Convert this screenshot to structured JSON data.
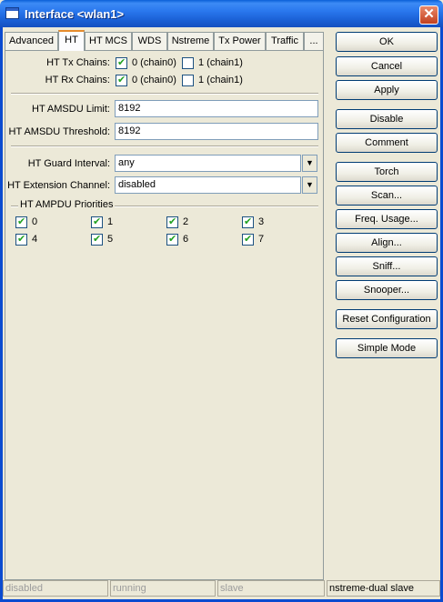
{
  "window": {
    "title": "Interface <wlan1>",
    "icon": "window-icon"
  },
  "tabs": [
    {
      "label": "Advanced",
      "active": false
    },
    {
      "label": "HT",
      "active": true
    },
    {
      "label": "HT MCS",
      "active": false
    },
    {
      "label": "WDS",
      "active": false
    },
    {
      "label": "Nstreme",
      "active": false
    },
    {
      "label": "Tx Power",
      "active": false
    },
    {
      "label": "Traffic",
      "active": false
    },
    {
      "label": "...",
      "active": false
    }
  ],
  "ht": {
    "tx_chains": {
      "label": "HT Tx Chains:",
      "chain0": {
        "label": "0 (chain0)",
        "checked": true
      },
      "chain1": {
        "label": "1 (chain1)",
        "checked": false
      }
    },
    "rx_chains": {
      "label": "HT Rx Chains:",
      "chain0": {
        "label": "0 (chain0)",
        "checked": true
      },
      "chain1": {
        "label": "1 (chain1)",
        "checked": false
      }
    },
    "amsdu_limit": {
      "label": "HT AMSDU Limit:",
      "value": "8192"
    },
    "amsdu_threshold": {
      "label": "HT AMSDU Threshold:",
      "value": "8192"
    },
    "guard_interval": {
      "label": "HT Guard Interval:",
      "value": "any"
    },
    "extension_channel": {
      "label": "HT Extension Channel:",
      "value": "disabled"
    },
    "ampdu": {
      "title": "HT AMPDU Priorities",
      "priorities": [
        {
          "label": "0",
          "checked": true
        },
        {
          "label": "1",
          "checked": true
        },
        {
          "label": "2",
          "checked": true
        },
        {
          "label": "3",
          "checked": true
        },
        {
          "label": "4",
          "checked": true
        },
        {
          "label": "5",
          "checked": true
        },
        {
          "label": "6",
          "checked": true
        },
        {
          "label": "7",
          "checked": true
        }
      ]
    }
  },
  "buttons": {
    "ok": "OK",
    "cancel": "Cancel",
    "apply": "Apply",
    "disable": "Disable",
    "comment": "Comment",
    "torch": "Torch",
    "scan": "Scan...",
    "freq_usage": "Freq. Usage...",
    "align": "Align...",
    "sniff": "Sniff...",
    "snooper": "Snooper...",
    "reset": "Reset Configuration",
    "simple_mode": "Simple Mode"
  },
  "status": {
    "s1": "disabled",
    "s2": "running",
    "s3": "slave",
    "s4": "nstreme-dual slave"
  }
}
